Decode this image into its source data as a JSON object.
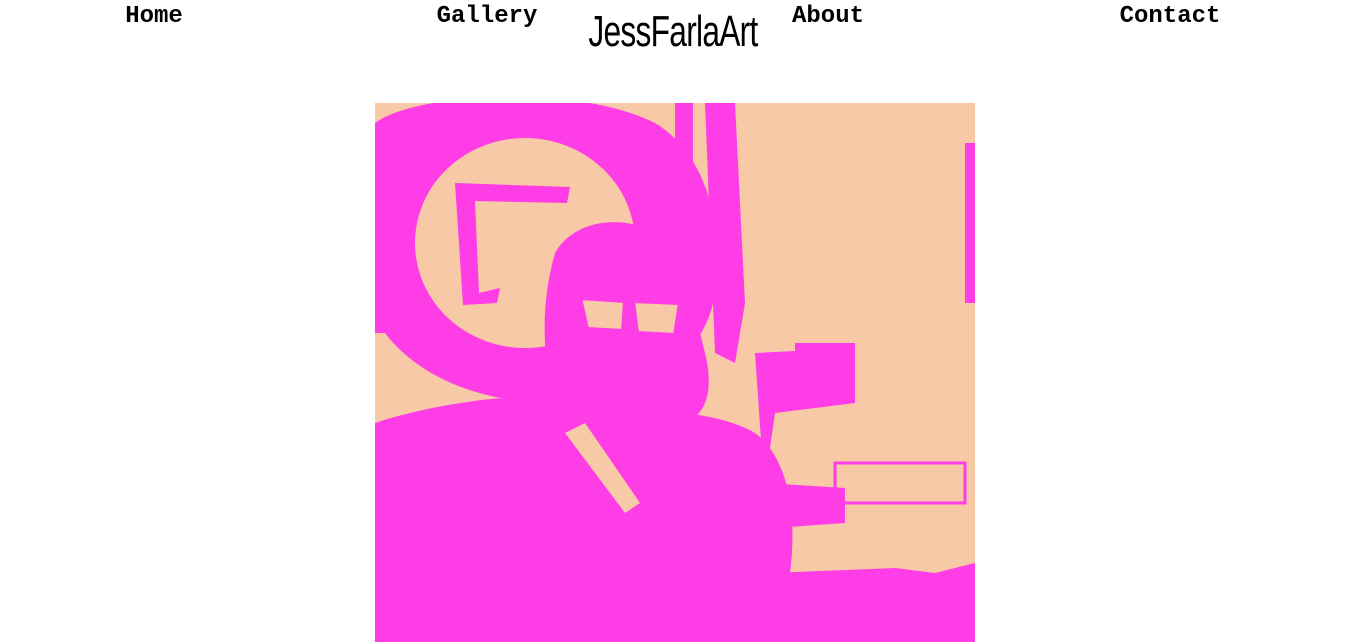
{
  "site": {
    "title": "JessFarlaArt"
  },
  "nav": {
    "items": [
      {
        "label": "Home"
      },
      {
        "label": "Gallery"
      },
      {
        "label": "About"
      },
      {
        "label": "Contact"
      }
    ]
  },
  "hero": {
    "colors": {
      "background": "#f8c9a6",
      "foreground": "#ff3de6"
    }
  }
}
